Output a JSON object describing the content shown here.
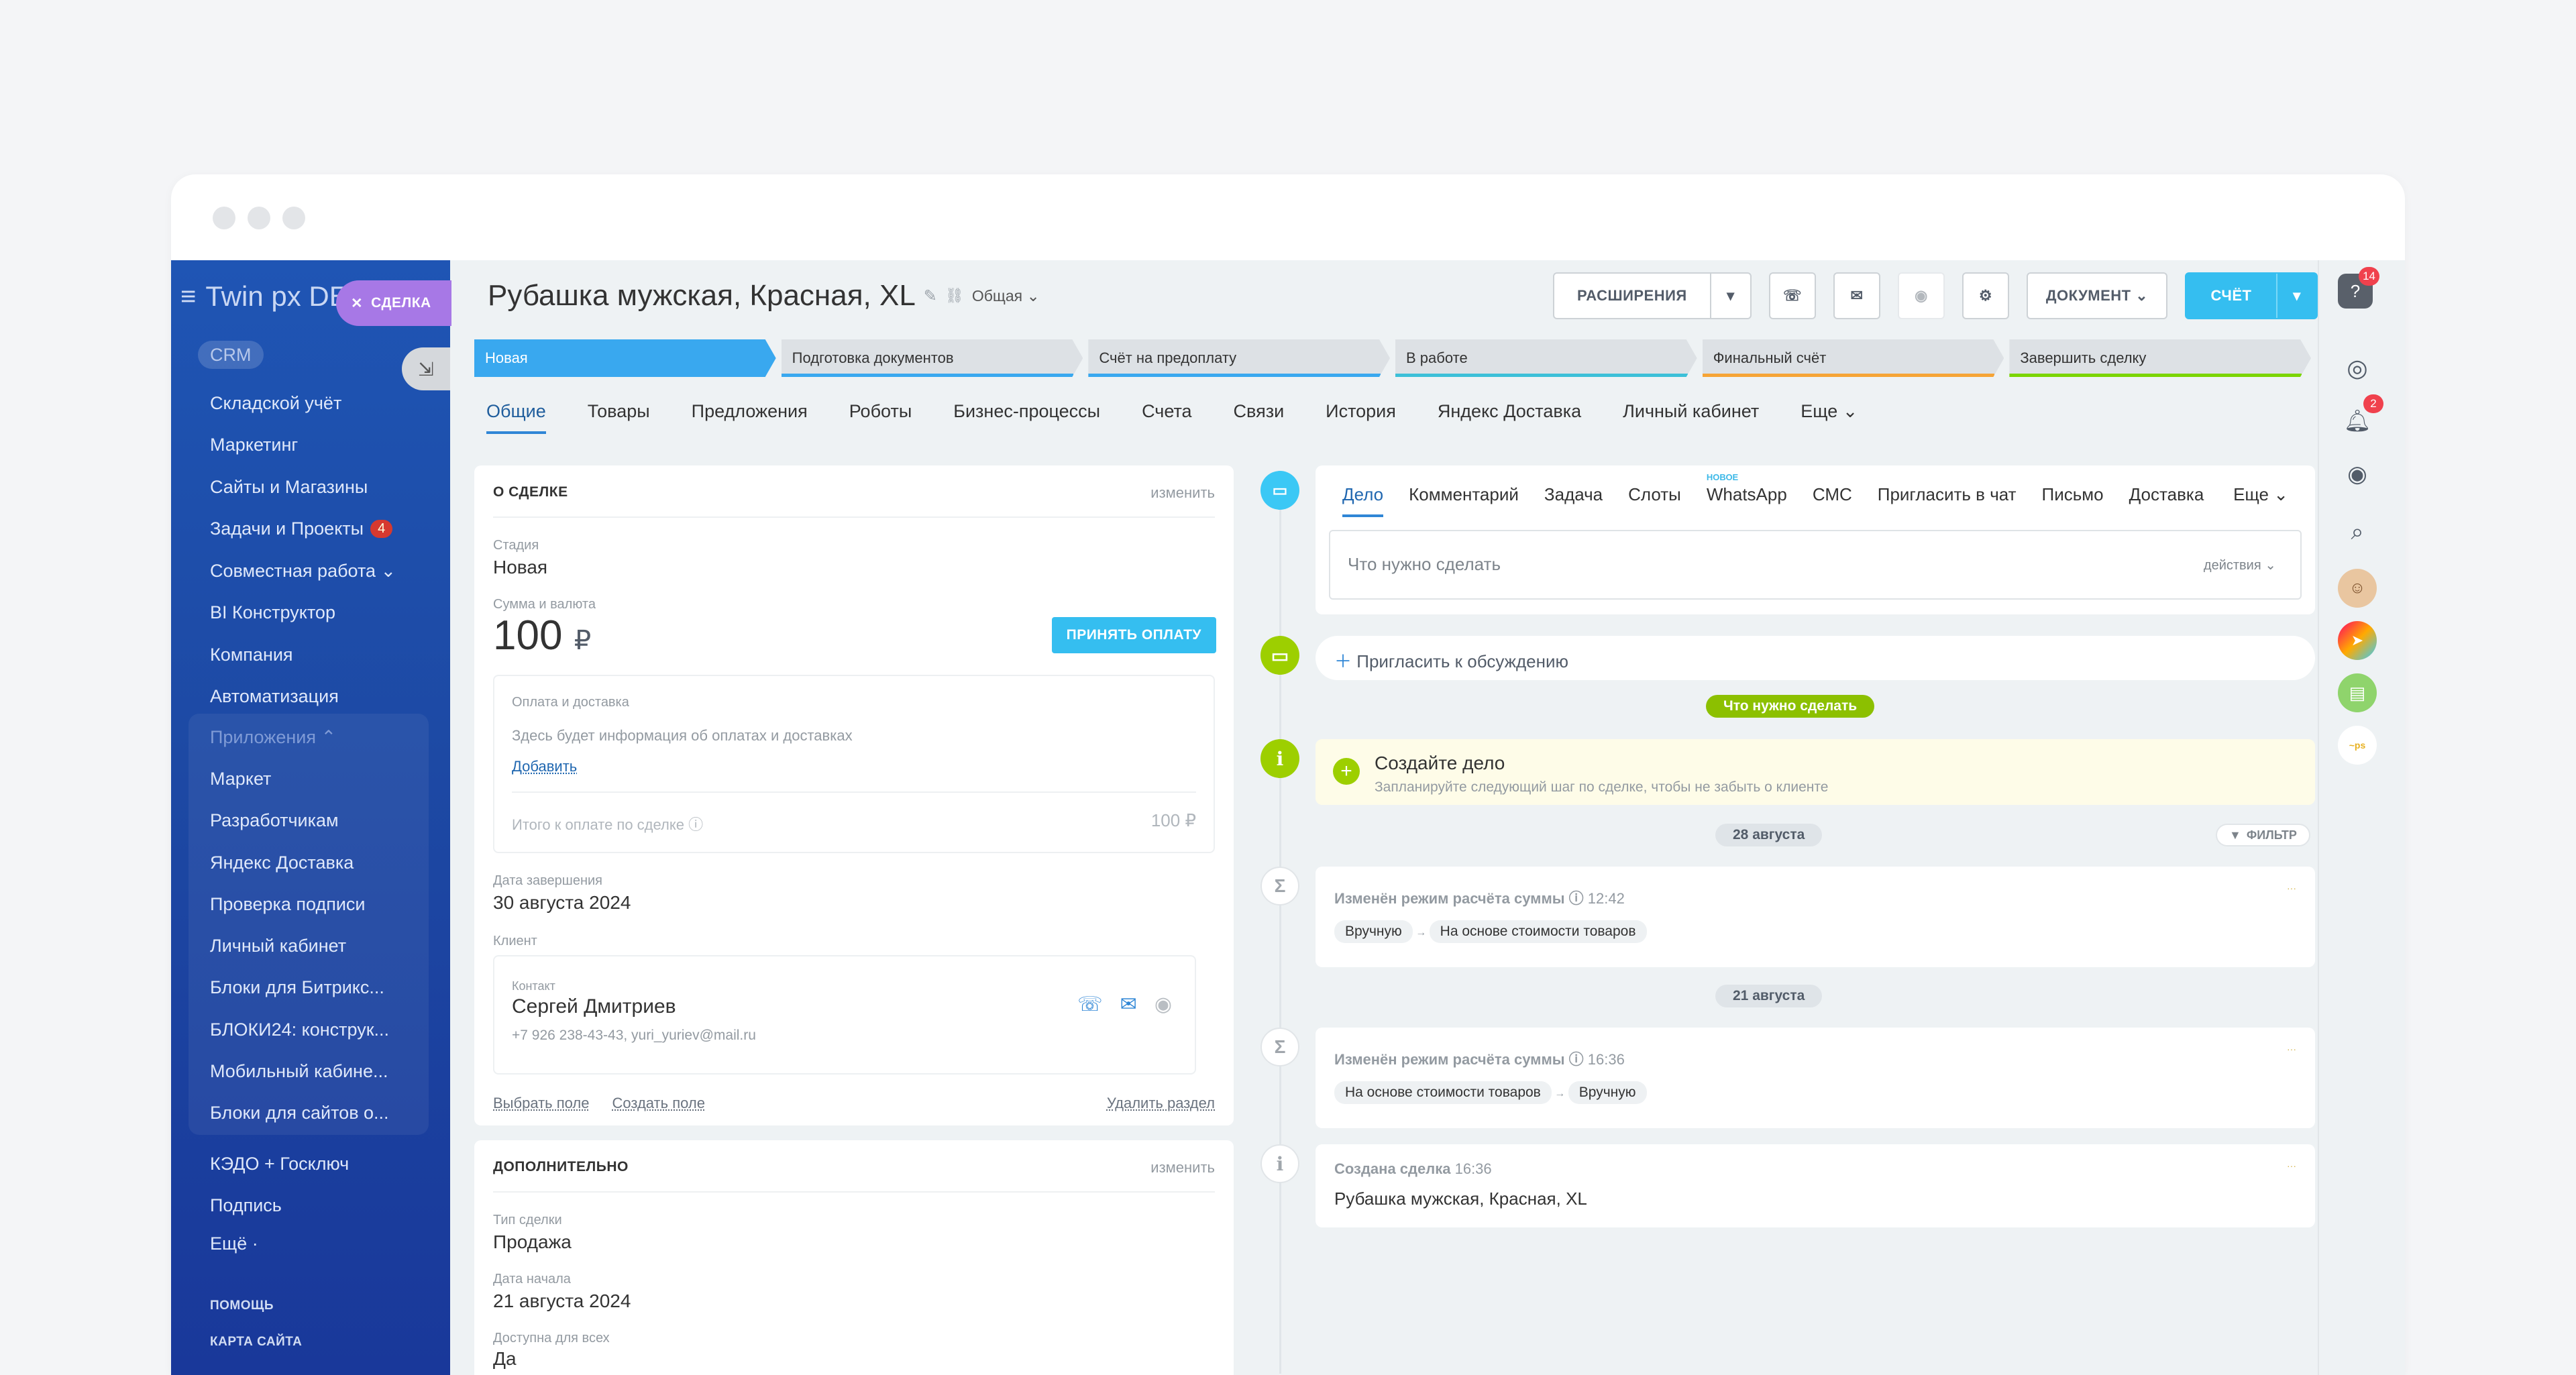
{
  "sidebar": {
    "brand": "Twin px DE",
    "deal_button": "СДЕЛКА",
    "crm": "CRM",
    "items": [
      {
        "label": "Складской учёт"
      },
      {
        "label": "Маркетинг"
      },
      {
        "label": "Сайты и Магазины"
      },
      {
        "label": "Задачи и Проекты",
        "badge": "4"
      },
      {
        "label": "Совместная работа ⌄"
      },
      {
        "label": "BI Конструктор"
      },
      {
        "label": "Компания"
      },
      {
        "label": "Автоматизация"
      }
    ],
    "apps_label": "Приложения ⌃",
    "apps": [
      {
        "label": "Маркет"
      },
      {
        "label": "Разработчикам"
      },
      {
        "label": "Яндекс Доставка"
      },
      {
        "label": "Проверка подписи"
      },
      {
        "label": "Личный кабинет"
      },
      {
        "label": "Блоки для Битрикс..."
      },
      {
        "label": "БЛОКИ24: конструк..."
      },
      {
        "label": "Мобильный кабине..."
      },
      {
        "label": "Блоки для сайтов о..."
      }
    ],
    "more_items": [
      {
        "label": "КЭДО + Госключ"
      },
      {
        "label": "Подпись"
      },
      {
        "label": "Ещё ·"
      }
    ],
    "help": "ПОМОЩЬ",
    "sitemap": "КАРТА САЙТА"
  },
  "header": {
    "title": "Рубашка мужская, Красная, XL",
    "category": "Общая",
    "extensions": "РАСШИРЕНИЯ",
    "document": "ДОКУМЕНТ",
    "invoice": "СЧЁТ"
  },
  "stages": [
    {
      "label": "Новая",
      "color": "#39a8ef",
      "active": true
    },
    {
      "label": "Подготовка документов",
      "color": "#39a8ef"
    },
    {
      "label": "Счёт на предоплату",
      "color": "#39a8ef"
    },
    {
      "label": "В работе",
      "color": "#3cc0d8"
    },
    {
      "label": "Финальный счёт",
      "color": "#f6a436"
    },
    {
      "label": "Завершить сделку",
      "color": "#7bd500"
    }
  ],
  "tabs": [
    "Общие",
    "Товары",
    "Предложения",
    "Роботы",
    "Бизнес-процессы",
    "Счета",
    "Связи",
    "История",
    "Яндекс Доставка",
    "Личный кабинет",
    "Еще"
  ],
  "about": {
    "head": "О СДЕЛКЕ",
    "edit": "изменить",
    "stage_label": "Стадия",
    "stage_value": "Новая",
    "amount_label": "Сумма и валюта",
    "amount": "100",
    "currency": "₽",
    "pay_button": "ПРИНЯТЬ ОПЛАТУ",
    "payment_title": "Оплата и доставка",
    "payment_hint": "Здесь будет информация об оплатах и доставках",
    "add": "Добавить",
    "total_label": "Итого к оплате по сделке",
    "total_value": "100 ₽",
    "close_label": "Дата завершения",
    "close_value": "30 августа 2024",
    "client_label": "Клиент",
    "contact_label": "Контакт",
    "contact_name": "Сергей Дмитриев",
    "contact_info": "+7 926 238-43-43, yuri_yuriev@mail.ru",
    "choose_field": "Выбрать поле",
    "create_field": "Создать поле",
    "delete_section": "Удалить раздел"
  },
  "extra": {
    "head": "ДОПОЛНИТЕЛЬНО",
    "edit": "изменить",
    "type_label": "Тип сделки",
    "type_value": "Продажа",
    "start_label": "Дата начала",
    "start_value": "21 августа 2024",
    "public_label": "Доступна для всех",
    "public_value": "Да"
  },
  "activity": {
    "tabs": [
      "Дело",
      "Комментарий",
      "Задача",
      "Слоты",
      "WhatsApp",
      "СМС",
      "Пригласить в чат",
      "Письмо",
      "Доставка"
    ],
    "new_badge": "НОВОЕ",
    "more": "Еще",
    "placeholder": "Что нужно сделать",
    "actions": "действия",
    "invite": "Пригласить к обсуждению",
    "todo_pill": "Что нужно сделать",
    "create_title": "Создайте дело",
    "create_hint": "Запланируйте следующий шаг по сделке, чтобы не забыть о клиенте",
    "filter": "ФИЛЬТР",
    "date1": "28 августа",
    "date2": "21 августа",
    "events": [
      {
        "title": "Изменён режим расчёта суммы",
        "time": "12:42",
        "from": "Вручную",
        "to": "На основе стоимости товаров"
      },
      {
        "title": "Изменён режим расчёта суммы",
        "time": "16:36",
        "from": "На основе стоимости товаров",
        "to": "Вручную"
      }
    ],
    "created_title": "Создана сделка",
    "created_time": "16:36",
    "created_body": "Рубашка мужская, Красная, XL"
  },
  "rightbar": {
    "help_badge": "14",
    "notif_badge": "2"
  }
}
